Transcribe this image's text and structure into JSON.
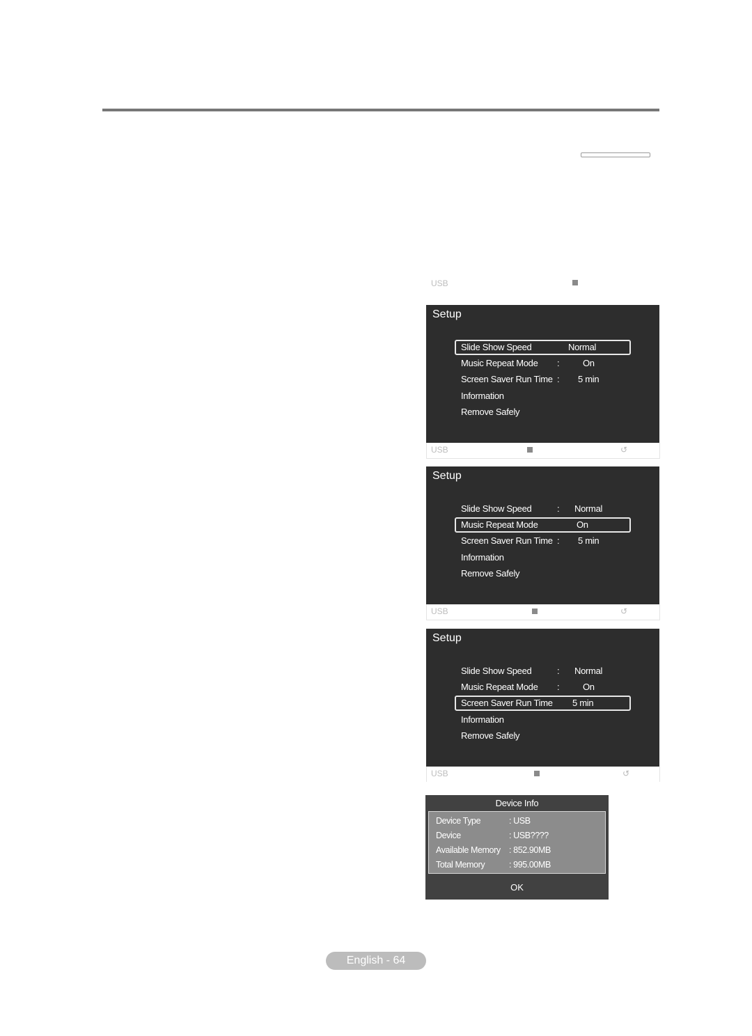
{
  "header_usb": {
    "label": "USB",
    "icon": "stop-square-icon"
  },
  "panels": [
    {
      "title": "Setup",
      "items": [
        {
          "label": "Slide Show Speed",
          "colon": ":",
          "value": "Normal",
          "selected": true
        },
        {
          "label": "Music Repeat Mode",
          "colon": ":",
          "value": "On"
        },
        {
          "label": "Screen Saver Run Time",
          "colon": ":",
          "value": "5 min"
        },
        {
          "label": "Information"
        },
        {
          "label": "Remove Safely"
        }
      ],
      "footer": {
        "label": "USB",
        "icons": [
          "stop-square-icon",
          "return-icon"
        ]
      }
    },
    {
      "title": "Setup",
      "items": [
        {
          "label": "Slide Show Speed",
          "colon": ":",
          "value": "Normal"
        },
        {
          "label": "Music Repeat Mode",
          "colon": ":",
          "value": "On",
          "selected": true
        },
        {
          "label": "Screen Saver Run Time",
          "colon": ":",
          "value": "5 min"
        },
        {
          "label": "Information"
        },
        {
          "label": "Remove Safely"
        }
      ],
      "footer": {
        "label": "USB",
        "icons": [
          "stop-square-icon",
          "return-icon"
        ]
      }
    },
    {
      "title": "Setup",
      "items": [
        {
          "label": "Slide Show Speed",
          "colon": ":",
          "value": "Normal"
        },
        {
          "label": "Music Repeat Mode",
          "colon": ":",
          "value": "On"
        },
        {
          "label": "Screen Saver Run Time",
          "colon": ":",
          "value": "5 min",
          "selected": true
        },
        {
          "label": "Information"
        },
        {
          "label": "Remove Safely"
        }
      ],
      "footer": {
        "label": "USB",
        "icons": [
          "stop-square-icon",
          "return-icon"
        ]
      }
    }
  ],
  "return_glyph": "↺",
  "device_info": {
    "title": "Device Info",
    "rows": [
      {
        "key": "Device Type",
        "value": ": USB"
      },
      {
        "key": "Device",
        "value": ": USB????"
      },
      {
        "key": "Available Memory",
        "value": ": 852.90MB"
      },
      {
        "key": "Total Memory",
        "value": ": 995.00MB"
      }
    ],
    "ok_label": "OK"
  },
  "page_label": "English - 64"
}
